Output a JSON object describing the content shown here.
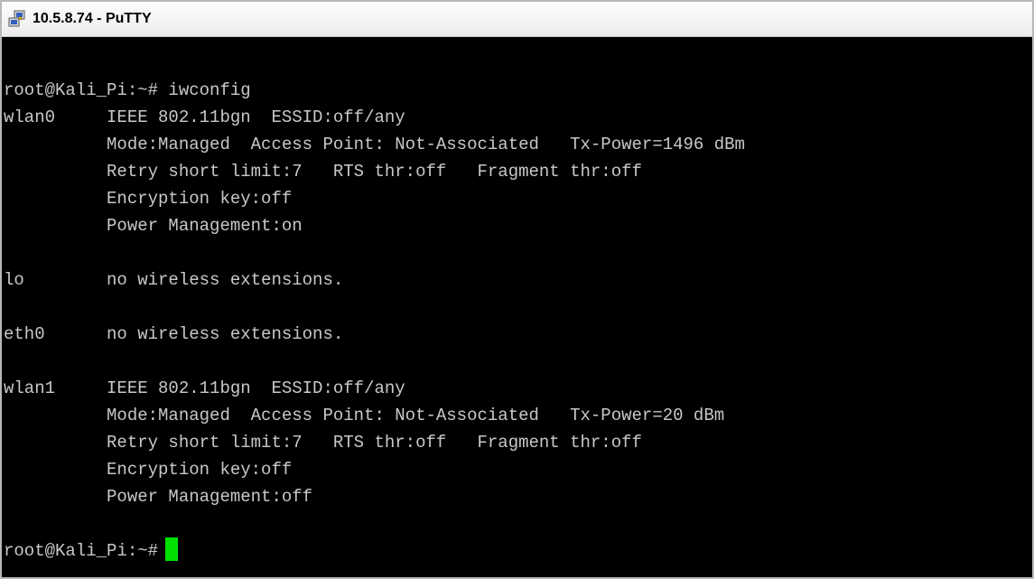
{
  "window": {
    "title": "10.5.8.74 - PuTTY",
    "icon": "putty-icon"
  },
  "terminal": {
    "lines": [
      "root@Kali_Pi:~# iwconfig",
      "wlan0     IEEE 802.11bgn  ESSID:off/any",
      "          Mode:Managed  Access Point: Not-Associated   Tx-Power=1496 dBm",
      "          Retry short limit:7   RTS thr:off   Fragment thr:off",
      "          Encryption key:off",
      "          Power Management:on",
      "",
      "lo        no wireless extensions.",
      "",
      "eth0      no wireless extensions.",
      "",
      "wlan1     IEEE 802.11bgn  ESSID:off/any",
      "          Mode:Managed  Access Point: Not-Associated   Tx-Power=20 dBm",
      "          Retry short limit:7   RTS thr:off   Fragment thr:off",
      "          Encryption key:off",
      "          Power Management:off",
      "",
      "root@Kali_Pi:~#"
    ],
    "colors": {
      "background": "#000000",
      "text": "#c8c8c8",
      "cursor": "#00e000"
    }
  }
}
